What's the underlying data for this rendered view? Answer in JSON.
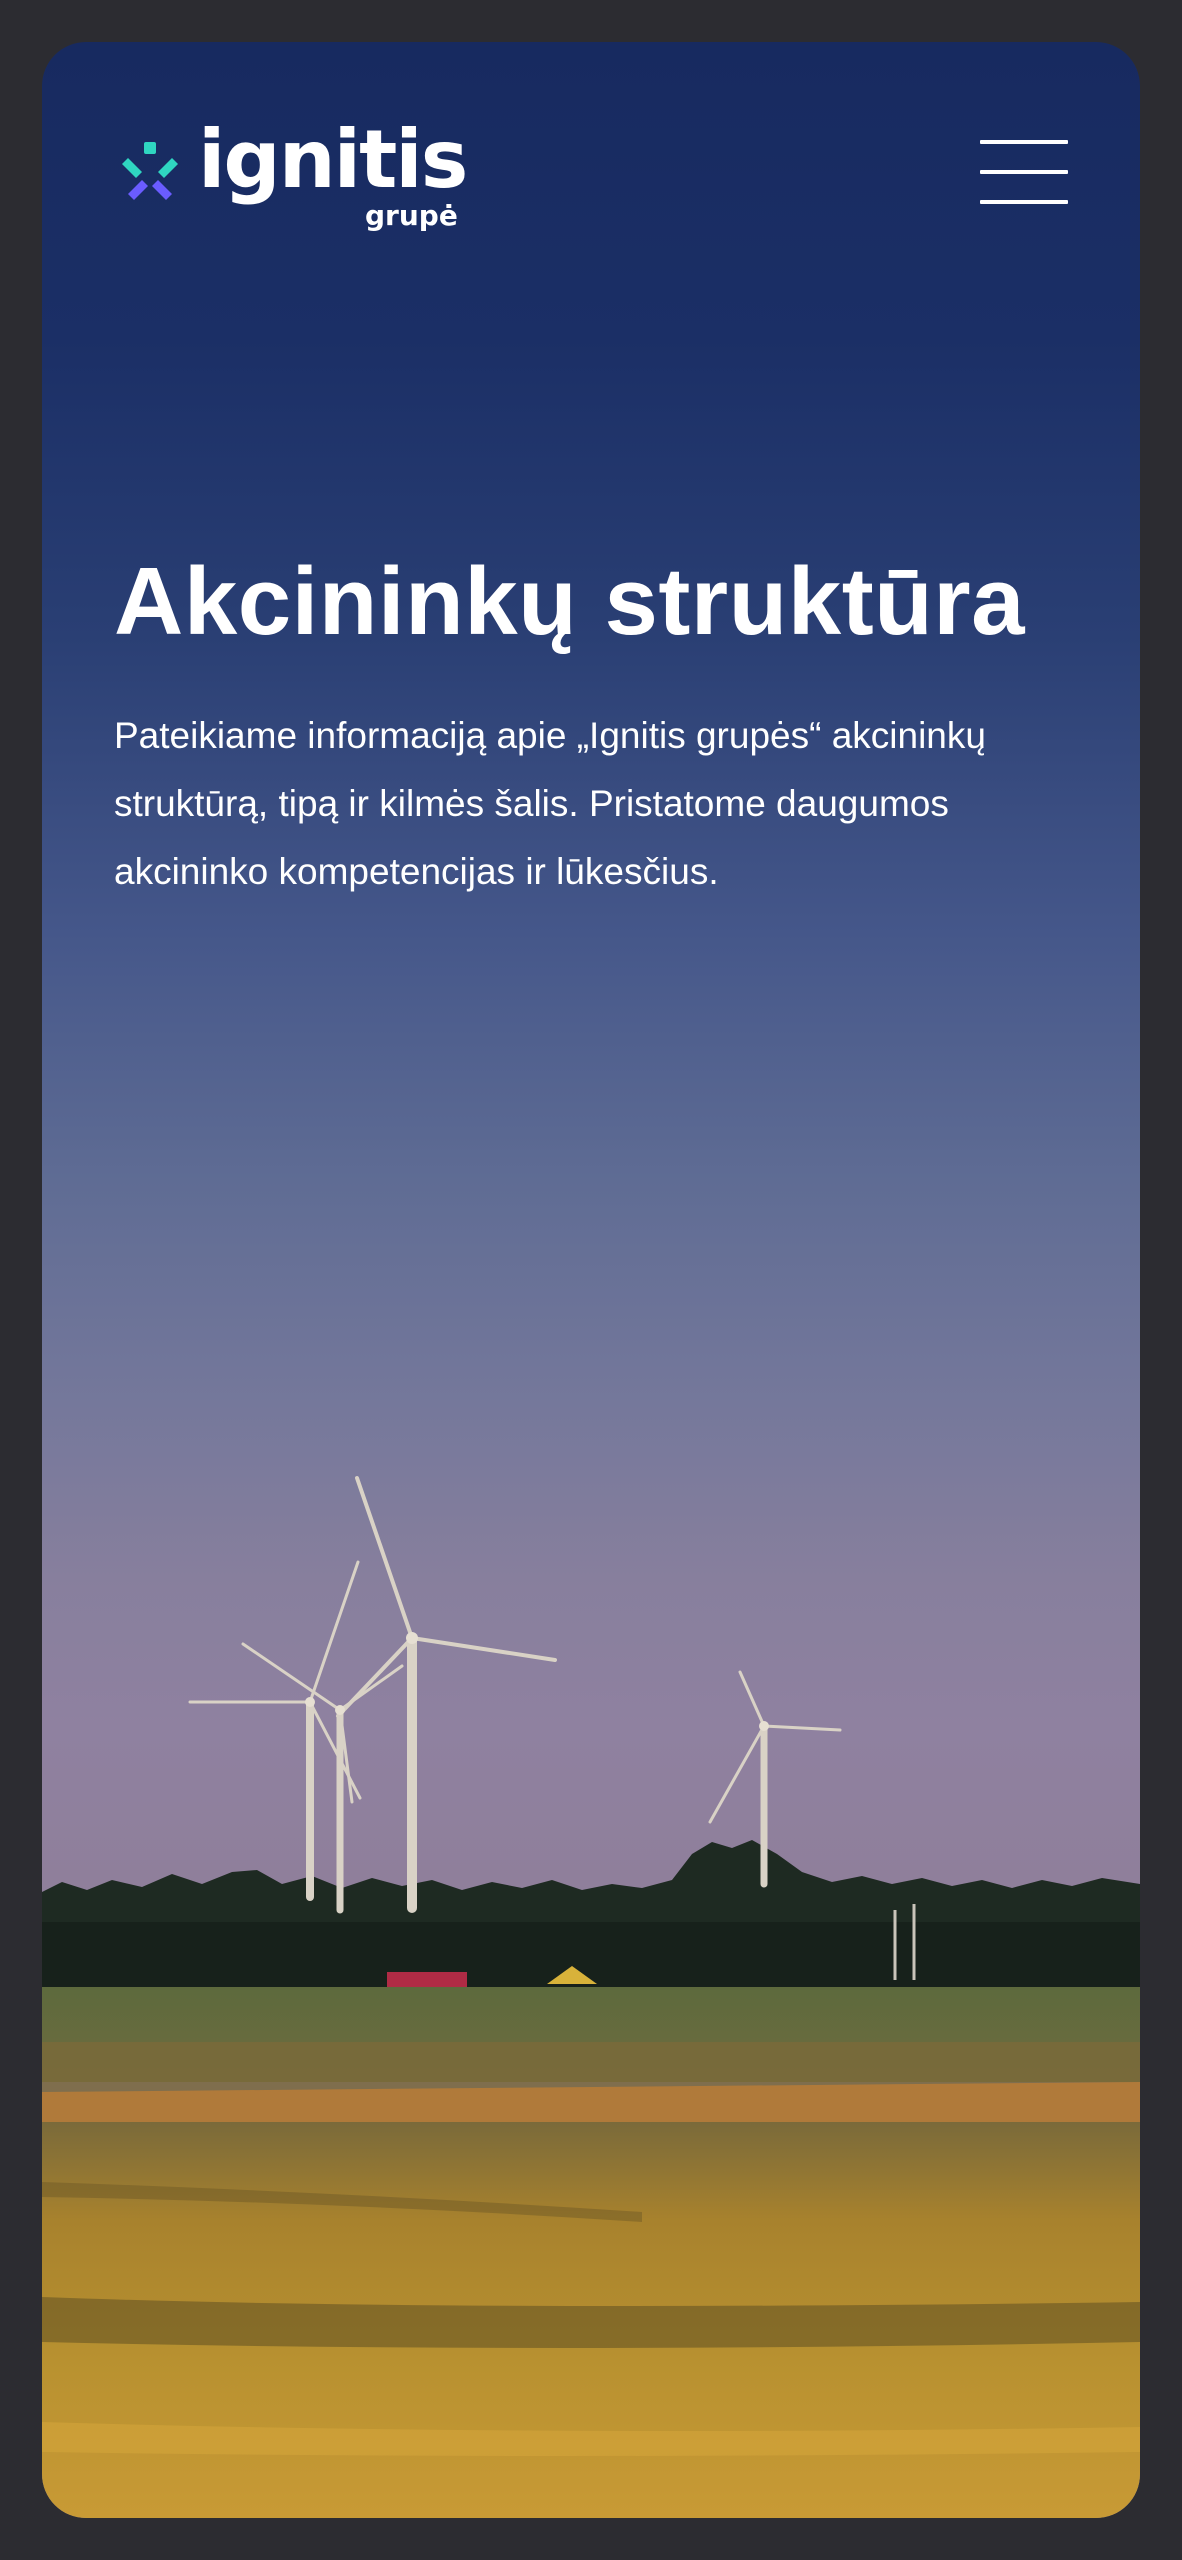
{
  "header": {
    "logo_name": "ignitis",
    "logo_subtitle": "grupė",
    "menu_icon": "hamburger-menu-icon"
  },
  "hero": {
    "title": "Akcininkų struktūra",
    "description": "Pateikiame informaciją apie „Ignitis grupės“ akcininkų struktūrą, tipą ir kilmės šalis. Pristatome daugumos akcininko kompetencijas ir lūkesčius."
  },
  "colors": {
    "frame": "#2c2c31",
    "sky_top": "#172a60",
    "sky_bottom": "#8f81a0",
    "field": "#b58a2a",
    "logo_teal": "#2fd6c1",
    "logo_violet": "#6a5cff",
    "text": "#ffffff"
  }
}
